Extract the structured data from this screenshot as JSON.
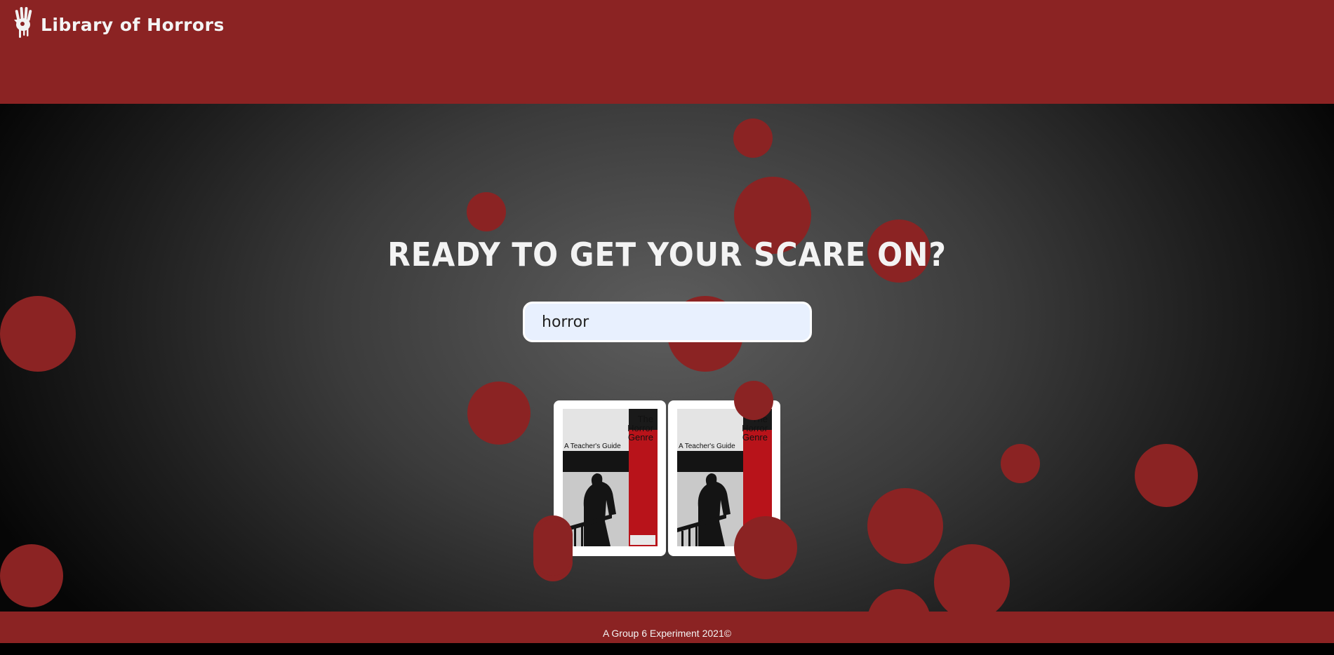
{
  "header": {
    "brand_name": "Library of Horrors",
    "brand_icon": "bloody-hand-icon"
  },
  "main": {
    "headline": "READY TO GET YOUR SCARE ON?",
    "search": {
      "value": "horror",
      "placeholder": ""
    },
    "results": [
      {
        "title_line1": "The",
        "title_line2": "Horror",
        "title_line3": "Genre",
        "subtitle": "A Teacher's Guide"
      },
      {
        "title_line1": "The",
        "title_line2": "Horror",
        "title_line3": "Genre",
        "subtitle": "A Teacher's Guide"
      }
    ]
  },
  "footer": {
    "text": "A Group 6 Experiment 2021©"
  },
  "colors": {
    "brand_red": "#8b2323",
    "search_bg": "#e8f0fe",
    "text_light": "#f4f4f4"
  }
}
